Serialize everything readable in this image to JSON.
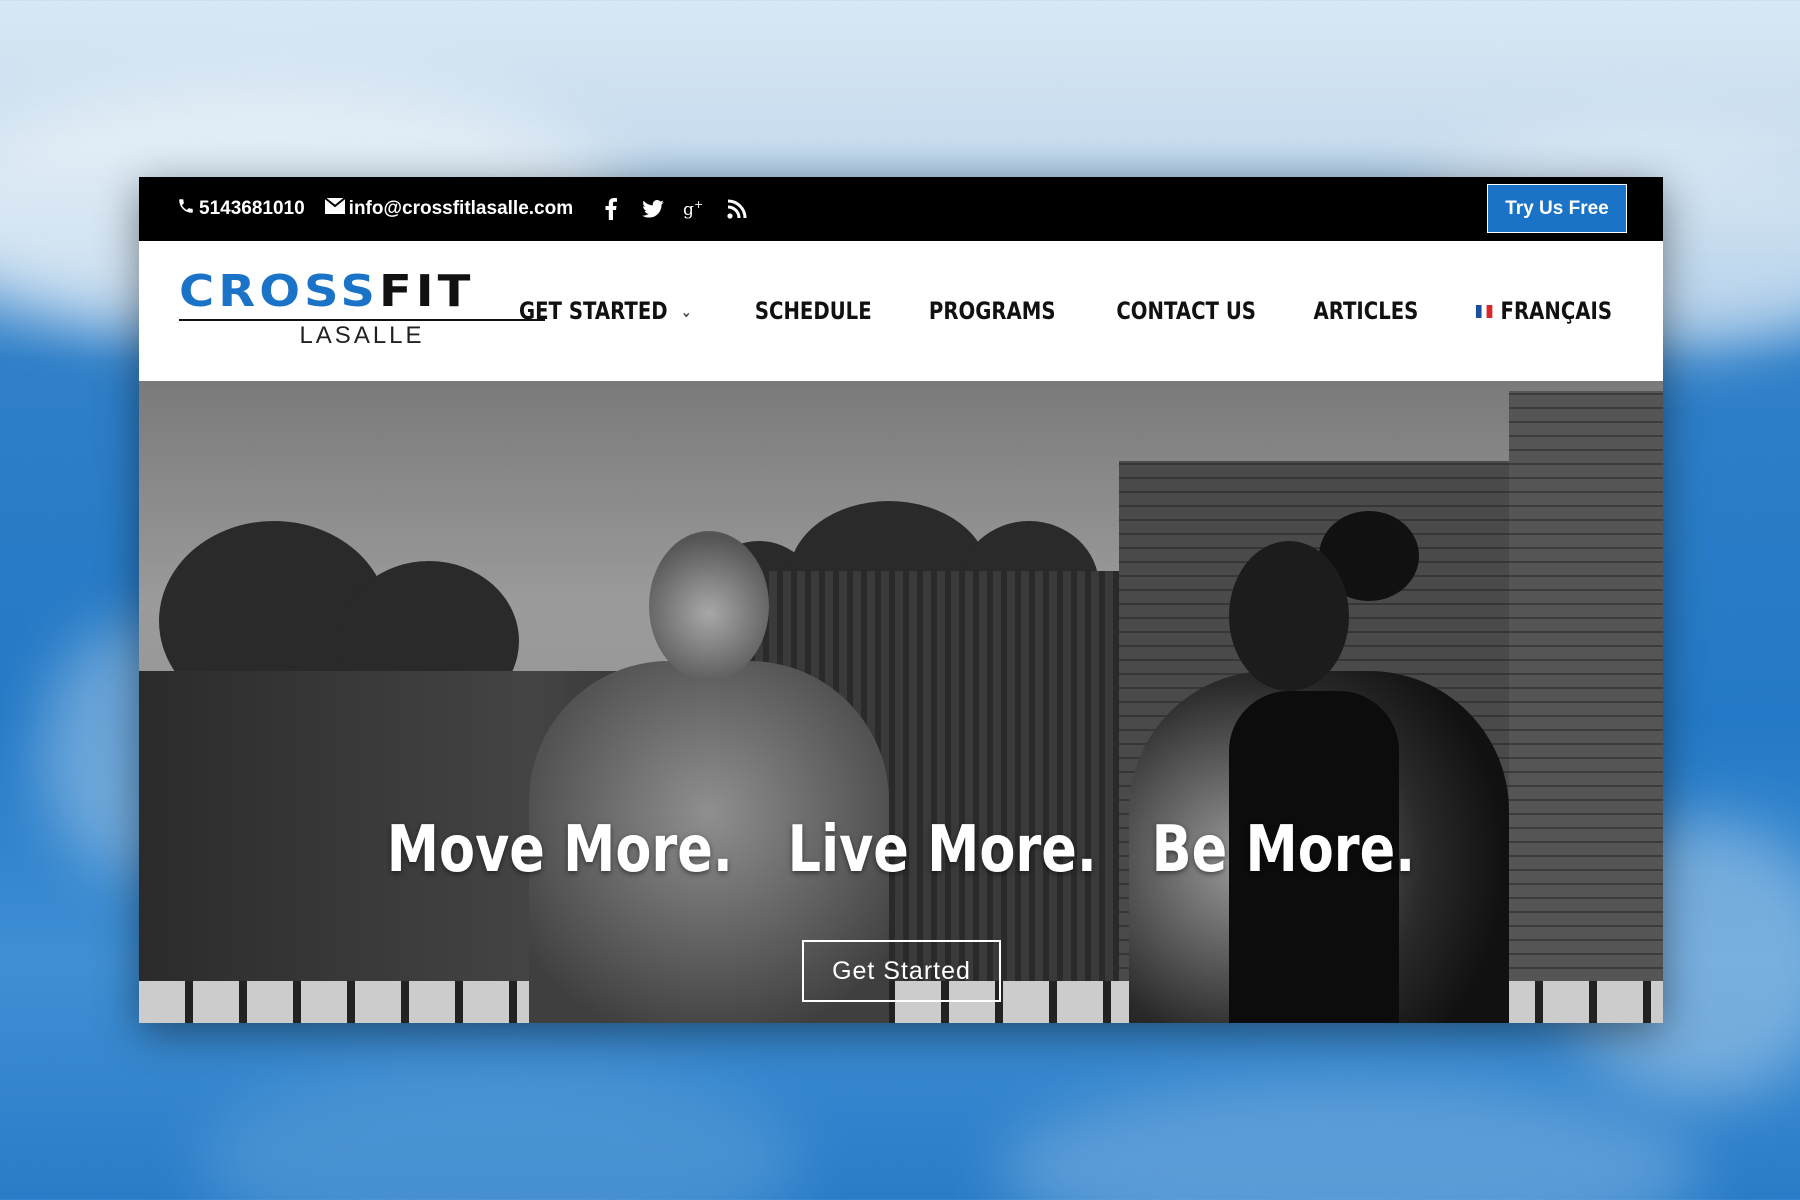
{
  "topbar": {
    "phone": "5143681010",
    "email": "info@crossfitlasalle.com",
    "social_icons": [
      "facebook-icon",
      "twitter-icon",
      "google-plus-icon",
      "rss-icon"
    ],
    "cta_label": "Try Us Free"
  },
  "logo": {
    "word_cross": "CROSS",
    "word_fit": "FIT",
    "subtitle": "LASALLE"
  },
  "nav": {
    "items": [
      {
        "label": "GET STARTED",
        "has_dropdown": true
      },
      {
        "label": "SCHEDULE"
      },
      {
        "label": "PROGRAMS"
      },
      {
        "label": "CONTACT US"
      },
      {
        "label": "ARTICLES"
      },
      {
        "label": "FRANÇAIS",
        "flag": "fr"
      }
    ]
  },
  "hero": {
    "headline": "Move More.   Live More.   Be More.",
    "button_label": "Get Started"
  },
  "colors": {
    "brand_blue": "#1a73c6",
    "topbar": "#000000"
  }
}
